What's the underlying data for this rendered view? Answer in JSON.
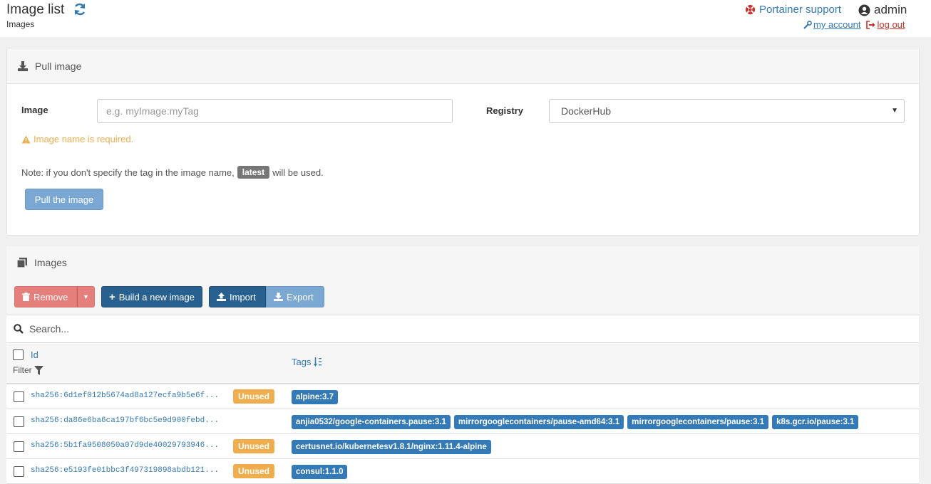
{
  "header": {
    "title": "Image list",
    "breadcrumb": "Images",
    "support_link": "Portainer support",
    "username": "admin",
    "my_account": "my account",
    "log_out": "log out"
  },
  "pull": {
    "title": "Pull image",
    "image_label": "Image",
    "image_placeholder": "e.g. myImage:myTag",
    "image_value": "",
    "registry_label": "Registry",
    "registry_value": "DockerHub",
    "warning": "Image name is required.",
    "note_prefix": "Note: if you don't specify the tag in the image name,",
    "note_badge": "latest",
    "note_suffix": "will be used.",
    "button": "Pull the image"
  },
  "images": {
    "title": "Images",
    "remove": "Remove",
    "build": "Build a new image",
    "import": "Import",
    "export": "Export",
    "search_placeholder": "Search...",
    "col_id": "Id",
    "col_filter": "Filter",
    "col_tags": "Tags",
    "rows": [
      {
        "id": "sha256:6d1ef012b5674ad8a127ecfa9b5e6f...",
        "unused": "Unused",
        "tags": [
          "alpine:3.7"
        ]
      },
      {
        "id": "sha256:da86e6ba6ca197bf6bc5e9d900febd...",
        "unused": "",
        "tags": [
          "anjia0532/google-containers.pause:3.1",
          "mirrorgooglecontainers/pause-amd64:3.1",
          "mirrorgooglecontainers/pause:3.1",
          "k8s.gcr.io/pause:3.1"
        ]
      },
      {
        "id": "sha256:5b1fa9508050a07d9de40029793946...",
        "unused": "Unused",
        "tags": [
          "certusnet.io/kubernetesv1.8.1/nginx:1.11.4-alpine"
        ]
      },
      {
        "id": "sha256:e5193fe01bbc3f497319898abdb121...",
        "unused": "Unused",
        "tags": [
          "consul:1.1.0"
        ]
      }
    ]
  }
}
